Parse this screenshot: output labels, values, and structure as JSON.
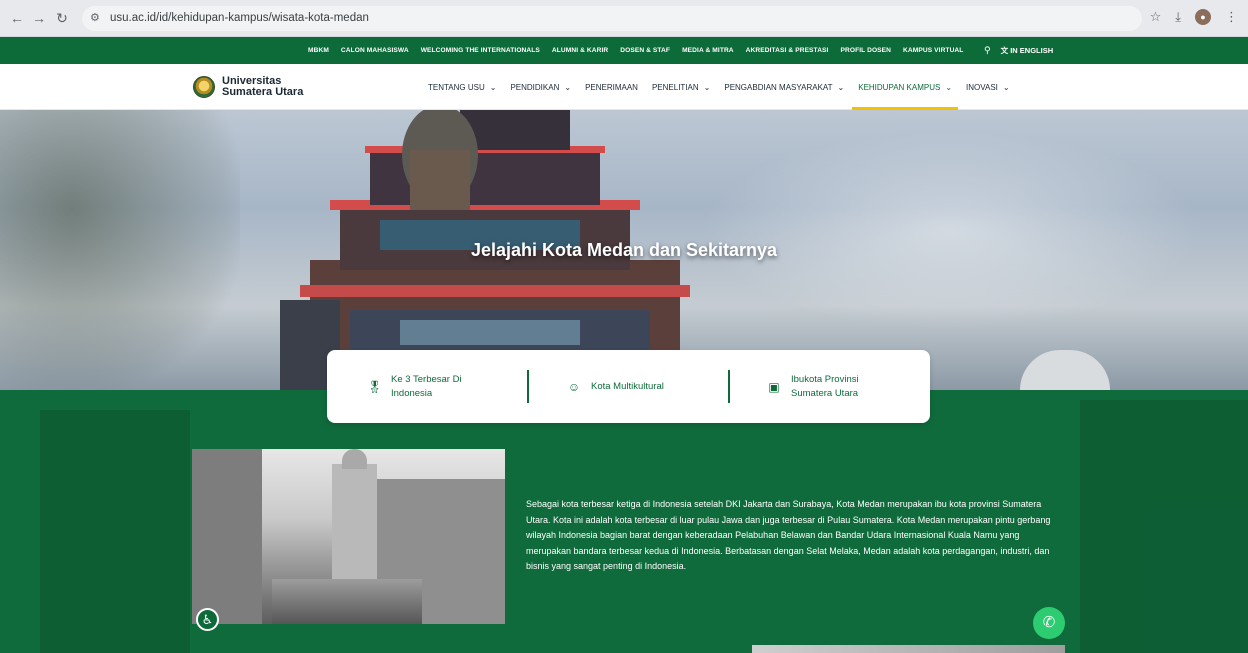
{
  "browser": {
    "url": "usu.ac.id/id/kehidupan-kampus/wisata-kota-medan",
    "back_icon": "arrow-left",
    "forward_icon": "arrow-right",
    "reload_icon": "reload",
    "site_info_icon": "tune"
  },
  "topbar": {
    "links": [
      "MBKM",
      "CALON MAHASISWA",
      "WELCOMING THE INTERNATIONALS",
      "ALUMNI & KARIR",
      "DOSEN & STAF",
      "MEDIA & MITRA",
      "AKREDITASI & PRESTASI",
      "PROFIL DOSEN",
      "KAMPUS VIRTUAL"
    ],
    "language_label": "IN ENGLISH"
  },
  "brand": {
    "line1": "Universitas",
    "line2": "Sumatera Utara"
  },
  "mainnav": {
    "items": [
      {
        "label": "TENTANG USU",
        "dropdown": true
      },
      {
        "label": "PENDIDIKAN",
        "dropdown": true
      },
      {
        "label": "PENERIMAAN",
        "dropdown": false
      },
      {
        "label": "PENELITIAN",
        "dropdown": true
      },
      {
        "label": "PENGABDIAN MASYARAKAT",
        "dropdown": true
      },
      {
        "label": "KEHIDUPAN KAMPUS",
        "dropdown": true,
        "active": true
      },
      {
        "label": "INOVASI",
        "dropdown": true
      }
    ]
  },
  "hero": {
    "title": "Jelajahi Kota Medan dan Sekitarnya"
  },
  "highlights": [
    {
      "icon": "medal-icon",
      "text_line1": "Ke 3 Terbesar Di",
      "text_line2": "Indonesia"
    },
    {
      "icon": "people-icon",
      "text_line1": "Kota Multikultural",
      "text_line2": ""
    },
    {
      "icon": "briefcase-icon",
      "text_line1": "Ibukota Provinsi",
      "text_line2": "Sumatera Utara"
    }
  ],
  "description": "Sebagai kota terbesar ketiga di Indonesia setelah DKI Jakarta dan Surabaya, Kota Medan merupakan ibu kota provinsi Sumatera Utara. Kota ini adalah kota terbesar di luar pulau Jawa dan juga terbesar di Pulau Sumatera. Kota Medan merupakan pintu gerbang wilayah Indonesia bagian barat dengan keberadaan Pelabuhan Belawan dan Bandar Udara Internasional Kuala Namu yang merupakan bandara terbesar kedua di Indonesia. Berbatasan dengan Selat Melaka, Medan adalah kota perdagangan, industri, dan bisnis yang sangat penting di Indonesia.",
  "colors": {
    "brand_green": "#0d6b3a",
    "accent_yellow": "#f2c100",
    "whatsapp_green": "#2ecc71"
  }
}
